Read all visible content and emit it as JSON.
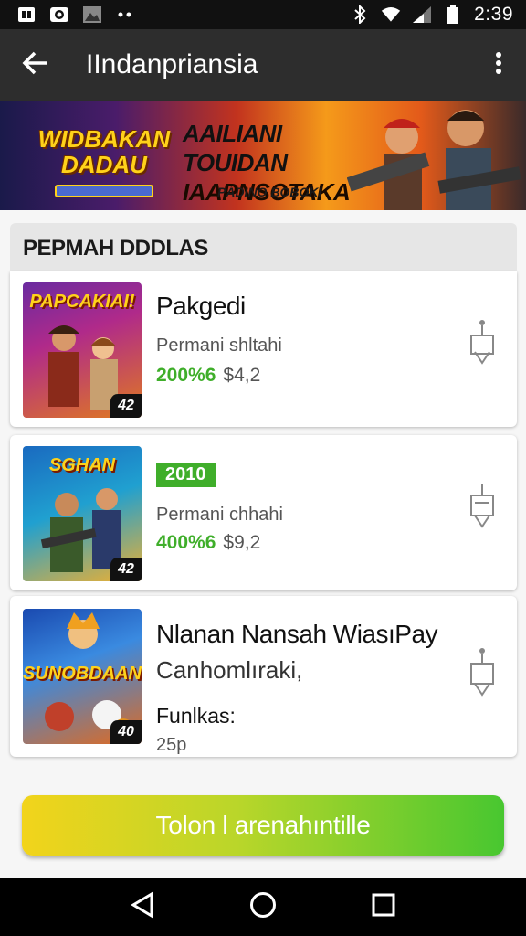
{
  "status_bar": {
    "time": "2:39",
    "icons": [
      "notification-icon",
      "camera-icon",
      "photo-icon",
      "more-dots-icon",
      "bluetooth-icon",
      "wifi-icon",
      "signal-icon",
      "battery-icon"
    ]
  },
  "app_bar": {
    "title": "IIndanpriansia",
    "back_icon": "arrow-back-icon",
    "more_icon": "more-vert-icon"
  },
  "banner": {
    "logo_text": "WIDBAKAN DADAU",
    "headline_line1": "AAILIANI TOUIDAN",
    "headline_line2": "IAAPNSOTAKA",
    "subtext": "PÁDINO BOBOKI"
  },
  "section": {
    "title": "PEPMAH DDDLAS"
  },
  "cards": [
    {
      "thumb_title": "PAPCAKIAI!",
      "badge": "42",
      "name": "Pakgedi",
      "subtitle": "Permani shltahi",
      "price_green": "200%6",
      "price_grey": "$4,2"
    },
    {
      "thumb_title": "SGHAN",
      "badge": "42",
      "tag": "2010",
      "subtitle": "Permani chhahi",
      "price_green": "400%6",
      "price_grey": "$9,2"
    },
    {
      "thumb_title": "SUNOBDAAN",
      "badge": "40",
      "name": "Nlanan Nansah WiasıPay",
      "subtitle": "Canhomlıraki,",
      "label": "Funlkas:",
      "value": "25p"
    }
  ],
  "cta": {
    "label": "Tolon l arenahıntille"
  },
  "nav_bar": {
    "icons": [
      "back-triangle-icon",
      "home-circle-icon",
      "recents-square-icon"
    ]
  },
  "colors": {
    "accent_green": "#3fae2a",
    "app_bar": "#2d2d2d",
    "cta_start": "#f2d41b",
    "cta_end": "#48c730"
  }
}
